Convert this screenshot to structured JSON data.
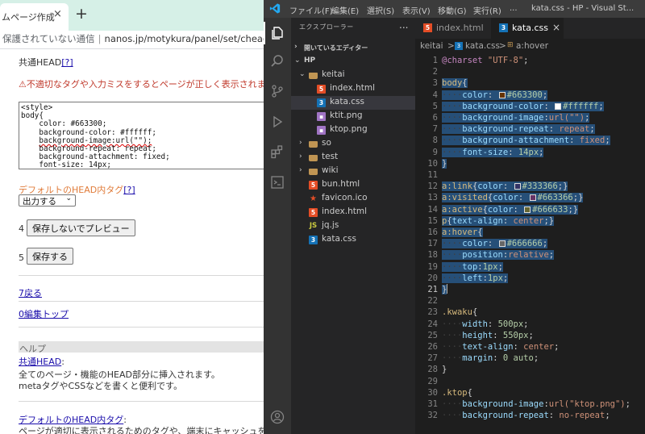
{
  "browser": {
    "tab_title": "ムページ作成",
    "tab_close": "×",
    "new_tab": "+",
    "address_security": "保護されていない通信",
    "address_url": "nanos.jp/motykura/panel/set/chead",
    "head_label": "共通HEAD",
    "head_help_link": "[?]",
    "warning_text": "⚠不適切なタグや入力ミスをするとページが正しく表示されません",
    "code_lines": [
      "<style>",
      "body{",
      "    color: #663300;",
      "    background-color: #ffffff;",
      "    background-image:url(\"\");",
      "    background-repeat: repeat;",
      "    background-attachment: fixed;",
      "    font-size: 14px;"
    ],
    "default_head_label": "デフォルトのHEAD内タグ",
    "default_head_help_link": "[?]",
    "output_select_value": "出力する",
    "preview_prefix": "4",
    "preview_button": "保存しないでプレビュー",
    "save_prefix": "5",
    "save_button": "保存する",
    "back_prefix": "7",
    "back_link": "戻る",
    "edit_top_prefix": "0",
    "edit_top_link": "編集トップ",
    "help_heading": "ヘルプ",
    "help_head_link": "共通HEAD",
    "help_head_colon": ":",
    "help_head_desc1": "全てのページ・機能のHEAD部分に挿入されます。",
    "help_head_desc2": "metaタグやCSSなどを書くと便利です。",
    "help_default_link": "デフォルトのHEAD内タグ",
    "help_default_colon": ":",
    "help_default_desc": "ページが適切に表示されるためのタグや、端末にキャッシュを残さ"
  },
  "vscode": {
    "menu": [
      "ファイル(F)",
      "編集(E)",
      "選択(S)",
      "表示(V)",
      "移動(G)",
      "実行(R)",
      "..."
    ],
    "window_title": "kata.css - HP - Visual St...",
    "explorer_header": "エクスプローラー",
    "explorer_more": "...",
    "open_editors": "開いているエディター",
    "tree": [
      {
        "label": "HP",
        "type": "root"
      },
      {
        "label": "keitai",
        "type": "folder-open"
      },
      {
        "label": "index.html",
        "type": "html"
      },
      {
        "label": "kata.css",
        "type": "css",
        "selected": true
      },
      {
        "label": "ktit.png",
        "type": "img"
      },
      {
        "label": "ktop.png",
        "type": "img"
      },
      {
        "label": "so",
        "type": "folder"
      },
      {
        "label": "test",
        "type": "folder"
      },
      {
        "label": "wiki",
        "type": "folder"
      },
      {
        "label": "bun.html",
        "type": "html"
      },
      {
        "label": "favicon.ico",
        "type": "fav"
      },
      {
        "label": "index.html",
        "type": "html"
      },
      {
        "label": "jq.js",
        "type": "js"
      },
      {
        "label": "kata.css",
        "type": "css"
      }
    ],
    "tabs": [
      {
        "label": "index.html",
        "icon": "5",
        "active": false
      },
      {
        "label": "kata.css",
        "icon": "3",
        "active": true,
        "close": "×"
      }
    ],
    "breadcrumb": [
      "keitai",
      ">",
      "kata.css",
      ">",
      "a:hover"
    ],
    "current_line": 21,
    "colors": {
      "c663300": "#663300",
      "cffffff": "#ffffff",
      "c333366": "#333366",
      "c663366": "#663366",
      "c666633": "#666633",
      "c666666": "#666666"
    },
    "lines": [
      "@charset \"UTF-8\";",
      "",
      "body{",
      "    color: #663300;",
      "    background-color: #ffffff;",
      "    background-image:url(\"\");",
      "    background-repeat: repeat;",
      "    background-attachment: fixed;",
      "    font-size: 14px;",
      "}",
      "",
      "a:link{color: #333366;}",
      "a:visited{color: #663366;}",
      "a:active{color: #666633;}",
      "p{text-align: center;}",
      "a:hover{",
      "    color: #666666;",
      "    position:relative;",
      "    top:1px;",
      "    left:1px;",
      "}",
      "",
      ".kwaku{",
      "    width: 500px;",
      "    height: 550px;",
      "    text-align: center;",
      "    margin: 0 auto;",
      "}",
      "",
      ".ktop{",
      "    background-image:url(\"ktop.png\");",
      "    background-repeat: no-repeat;"
    ]
  }
}
